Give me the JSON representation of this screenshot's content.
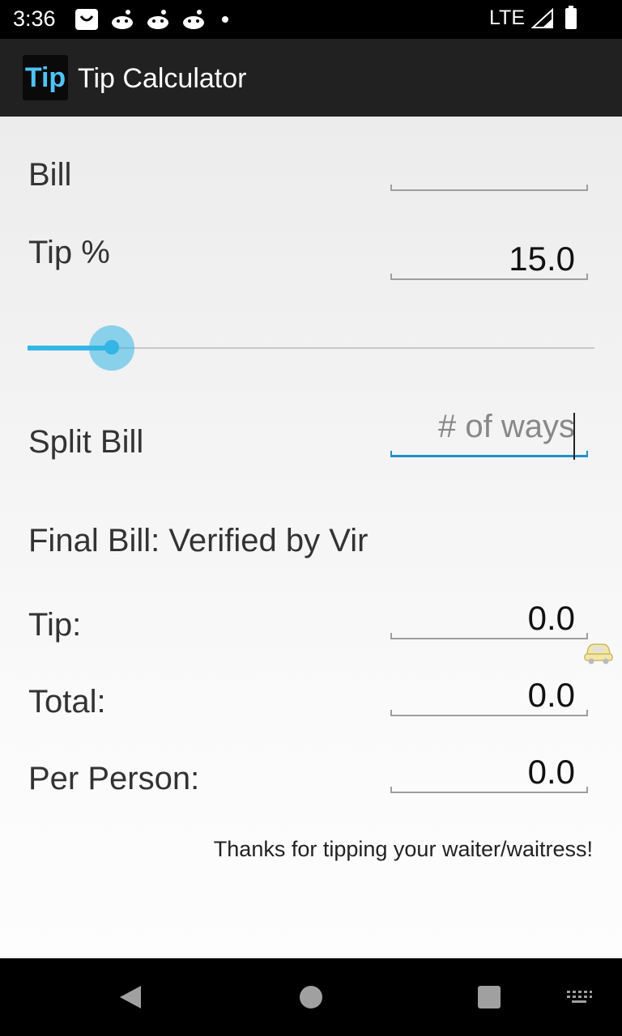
{
  "status_bar": {
    "time": "3:36",
    "network": "LTE",
    "icons": [
      "notification-bag-icon",
      "reddit-icon",
      "reddit-icon",
      "reddit-icon",
      "dot-icon",
      "signal-icon",
      "battery-icon"
    ]
  },
  "app": {
    "title": "Tip Calculator",
    "icon_text": "Tip",
    "accent_color": "#33b5e5"
  },
  "form": {
    "bill": {
      "label": "Bill",
      "value": ""
    },
    "tip_percent": {
      "label": "Tip %",
      "value": "15.0"
    },
    "slider": {
      "value_percent": 15
    },
    "split": {
      "label": "Split Bill",
      "placeholder": "# of ways",
      "value": ""
    }
  },
  "results": {
    "heading": "Final Bill: Verified by Vir",
    "tip": {
      "label": "Tip:",
      "value": "0.0"
    },
    "total": {
      "label": "Total:",
      "value": "0.0"
    },
    "per_person": {
      "label": "Per Person:",
      "value": "0.0"
    }
  },
  "footer": {
    "thanks": "Thanks for tipping your waiter/waitress!"
  },
  "nav_bar": {
    "buttons": [
      "back-icon",
      "home-icon",
      "recents-icon",
      "keyboard-icon"
    ]
  }
}
